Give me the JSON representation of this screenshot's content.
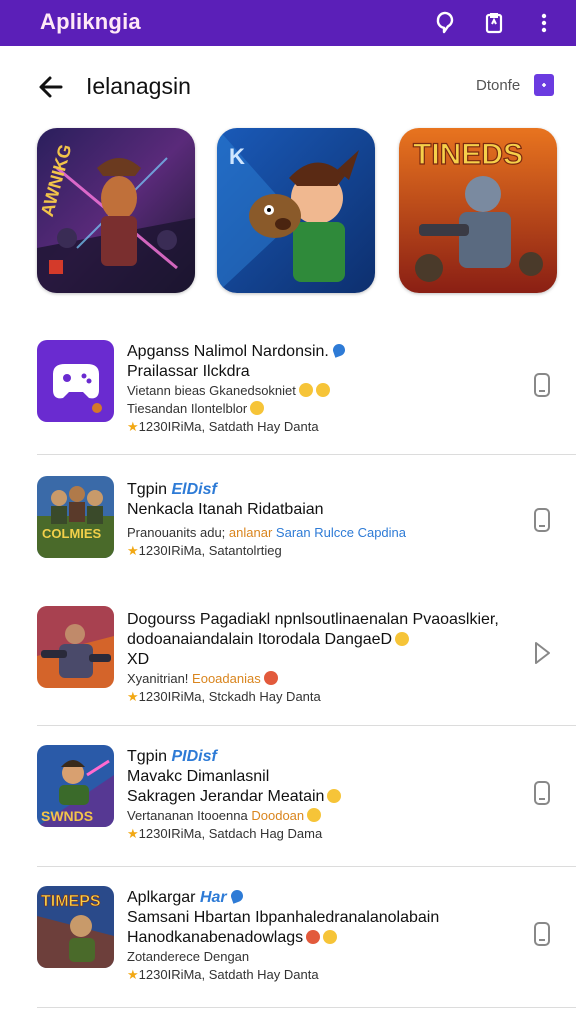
{
  "app": {
    "title": "Aplikngia"
  },
  "header": {
    "title": "Ielanagsin",
    "filter_label": "Dtonfe"
  },
  "featured": [
    {
      "name": "featured-card-1",
      "caption": "AWNIKG"
    },
    {
      "name": "featured-card-2",
      "caption": "K"
    },
    {
      "name": "featured-card-3",
      "caption": "TINEDS"
    }
  ],
  "list": [
    {
      "title": "Apganss Nalimol Nardonsin.",
      "line2": "Prailassar Ilckdra",
      "line3": "Vietann bieas Gkanedsokniet",
      "line4": "Tiesandan Ilontelblor",
      "rating": "1230IRiMa, Satdath Hay Danta"
    },
    {
      "title": "Tgpin",
      "title_tag": "ElDisf",
      "line2": "Nenkacla Itanah Ridatbaian",
      "line3_a": "Pranouanits adu;",
      "line3_b": "anlanar",
      "line3_c": "Saran Rulcce Capdina",
      "rating": "1230IRiMa, Satantolrtieg"
    },
    {
      "title": "Dogourss Pagadiakl npnlsoutlinaenalan Pvaoaslkier,",
      "line2": "dodoanaiandalain Itorodala DangaeD",
      "line3": "XD",
      "line4_a": "Xyanitrian!",
      "line4_b": "Eooadanias",
      "rating": "1230IRiMa, Stckadh Hay Danta"
    },
    {
      "title": "Tgpin",
      "title_tag": "PIDisf",
      "line2": "Mavakc Dimanlasnil",
      "line3": "Sakragen Jerandar Meatain",
      "line4_a": "Vertananan Itooenna",
      "line4_b": "Doodoan",
      "rating": "1230IRiMa, Satdach Hag Dama"
    },
    {
      "title": "Aplkargar",
      "title_tag": "Har",
      "line2": "Samsani Hbartan Ibpanhaledranalanolabain",
      "line3": "Hanodkanabenadowlags",
      "line4": "Zotanderece Dengan",
      "rating": "1230IRiMa, Satdath Hay Danta"
    }
  ],
  "colors": {
    "brand": "#5b1fb8",
    "accent_orange": "#d9851e",
    "accent_blue": "#2e7bd6",
    "star": "#f2a814"
  },
  "icons": [
    "back-arrow-icon",
    "chat-bubble-icon",
    "clipboard-icon",
    "more-vert-icon",
    "filter-icon",
    "phone-icon",
    "play-icon"
  ]
}
